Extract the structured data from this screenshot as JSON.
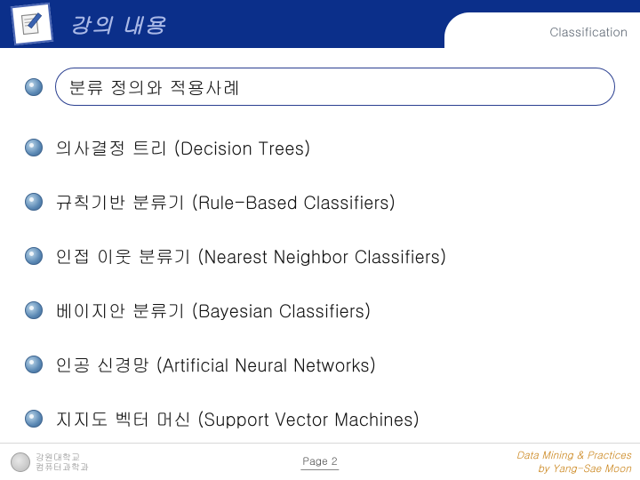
{
  "header": {
    "title": "강의 내용",
    "right_label": "Classification"
  },
  "bullets": [
    {
      "text": "분류 정의와 적용사례",
      "highlighted": true
    },
    {
      "text": "의사결정 트리 (Decision Trees)",
      "highlighted": false
    },
    {
      "text": "규칙기반 분류기 (Rule-Based Classifiers)",
      "highlighted": false
    },
    {
      "text": "인접 이웃 분류기 (Nearest Neighbor Classifiers)",
      "highlighted": false
    },
    {
      "text": "베이지안 분류기 (Bayesian Classifiers)",
      "highlighted": false
    },
    {
      "text": "인공 신경망 (Artificial Neural Networks)",
      "highlighted": false
    },
    {
      "text": "지지도 벡터 머신 (Support Vector Machines)",
      "highlighted": false
    }
  ],
  "footer": {
    "logo_text_line1": "강원대학교",
    "logo_text_line2": "컴퓨터과학과",
    "page_label": "Page 2",
    "credit_line1": "Data Mining & Practices",
    "credit_line2": "by Yang-Sae Moon"
  }
}
